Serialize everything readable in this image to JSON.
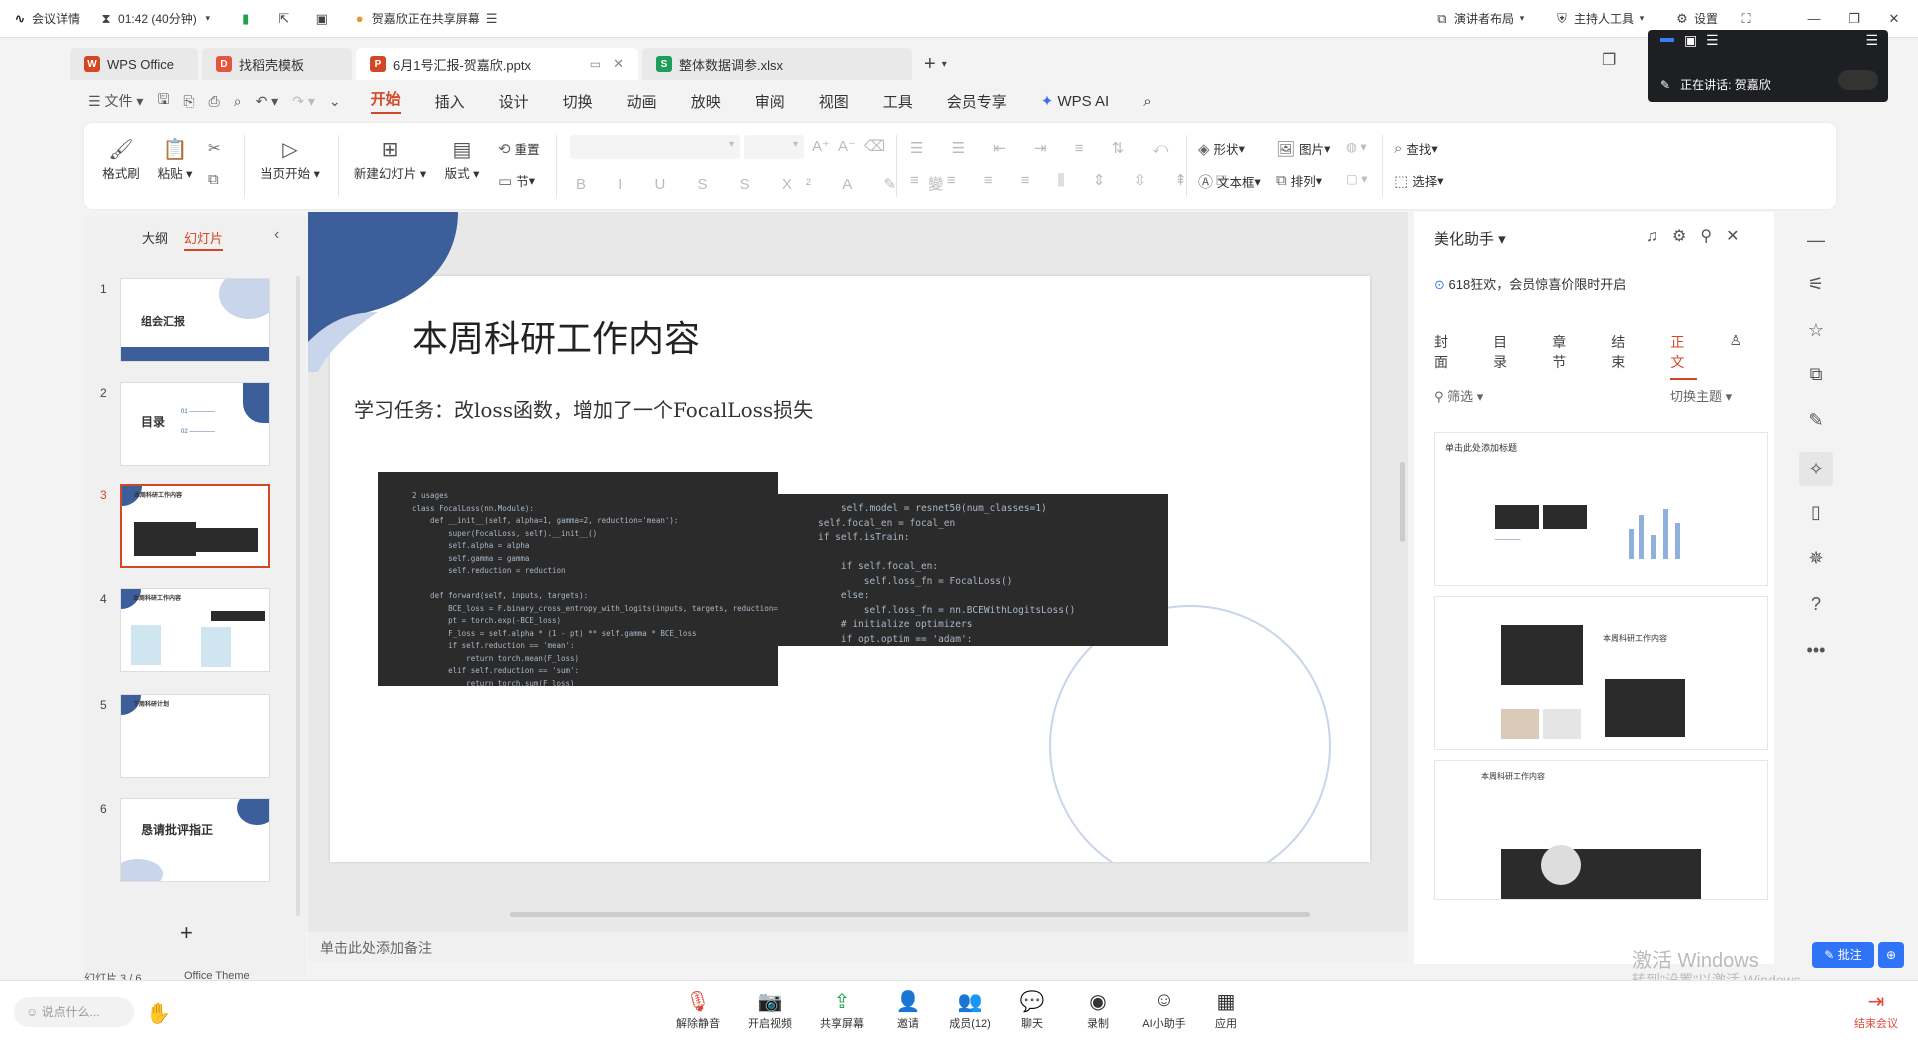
{
  "meeting": {
    "details": "会议详情",
    "timer": "01:42 (40分钟)",
    "sharing_notice": "贺嘉欣正在共享屏幕",
    "presenter_layout": "演讲者布局",
    "host_tools": "主持人工具",
    "settings": "设置",
    "speaking_label": "正在讲话:",
    "speaker_name": "贺嘉欣"
  },
  "tabs": [
    {
      "label": "WPS Office",
      "badge": "W",
      "color": "#d24726"
    },
    {
      "label": "找稻壳模板",
      "badge": "D",
      "color": "#e4563b"
    },
    {
      "label": "6月1号汇报-贺嘉欣.pptx",
      "badge": "P",
      "color": "#d24726"
    },
    {
      "label": "整体数据调参.xlsx",
      "badge": "S",
      "color": "#1f9e5b"
    }
  ],
  "menu": {
    "file": "文件",
    "items": [
      "开始",
      "插入",
      "设计",
      "切换",
      "动画",
      "放映",
      "审阅",
      "视图",
      "工具",
      "会员专享",
      "WPS AI"
    ]
  },
  "ribbon": {
    "format_painter": "格式刷",
    "paste": "粘贴",
    "play_from_current": "当页开始",
    "new_slide": "新建幻灯片",
    "layout": "版式",
    "reset": "重置",
    "section": "节",
    "shape": "形状",
    "picture": "图片",
    "find": "查找",
    "textbox": "文本框",
    "arrange": "排列",
    "select": "选择"
  },
  "left_panel": {
    "outline_tab": "大纲",
    "slides_tab": "幻灯片",
    "slides": [
      {
        "num": "1",
        "title": "组会汇报"
      },
      {
        "num": "2",
        "title": "目录"
      },
      {
        "num": "3",
        "title": "本周科研工作内容"
      },
      {
        "num": "4",
        "title": "本周科研工作内容"
      },
      {
        "num": "5",
        "title": "下周科研计划"
      },
      {
        "num": "6",
        "title": "恳请批评指正"
      }
    ],
    "add": "+"
  },
  "slide": {
    "title": "本周科研工作内容",
    "subtitle": "学习任务：改loss函数，增加了一个FocalLoss损失",
    "code_left": "2 usages\nclass FocalLoss(nn.Module):\n    def __init__(self, alpha=1, gamma=2, reduction='mean'):\n        super(FocalLoss, self).__init__()\n        self.alpha = alpha\n        self.gamma = gamma\n        self.reduction = reduction\n\n    def forward(self, inputs, targets):\n        BCE_loss = F.binary_cross_entropy_with_logits(inputs, targets, reduction='none')\n        pt = torch.exp(-BCE_loss)\n        F_loss = self.alpha * (1 - pt) ** self.gamma * BCE_loss\n        if self.reduction == 'mean':\n            return torch.mean(F_loss)\n        elif self.reduction == 'sum':\n            return torch.sum(F_loss)\n        else:\n            return F_loss",
    "code_right": "    self.model = resnet50(num_classes=1)\nself.focal_en = focal_en\nif self.isTrain:\n\n    if self.focal_en:\n        self.loss_fn = FocalLoss()\n    else:\n        self.loss_fn = nn.BCEWithLogitsLoss()\n    # initialize optimizers\n    if opt.optim == 'adam':"
  },
  "notes_placeholder": "单击此处添加备注",
  "right_panel": {
    "title": "美化助手",
    "promo": "618狂欢，会员惊喜价限时开启",
    "tabs": [
      "封面",
      "目录",
      "章节",
      "结束",
      "正文"
    ],
    "filter": "筛选",
    "switch_theme": "切换主题",
    "card1_title": "单击此处添加标题",
    "card2_title": "本周科研工作内容",
    "card3_title": "本周科研工作内容"
  },
  "watermark": {
    "line1": "激活 Windows",
    "line2": "转到\"设置\"以激活 Windows。"
  },
  "comment_btn": "批注",
  "bottom": {
    "say_placeholder": "说点什么...",
    "buttons": [
      "解除静音",
      "开启视频",
      "共享屏幕",
      "邀请",
      "成员(12)",
      "聊天",
      "录制",
      "AI小助手",
      "应用"
    ],
    "end": "结束会议"
  },
  "status": {
    "slide_count": "幻灯片 3 / 6",
    "theme": "Office Theme"
  }
}
